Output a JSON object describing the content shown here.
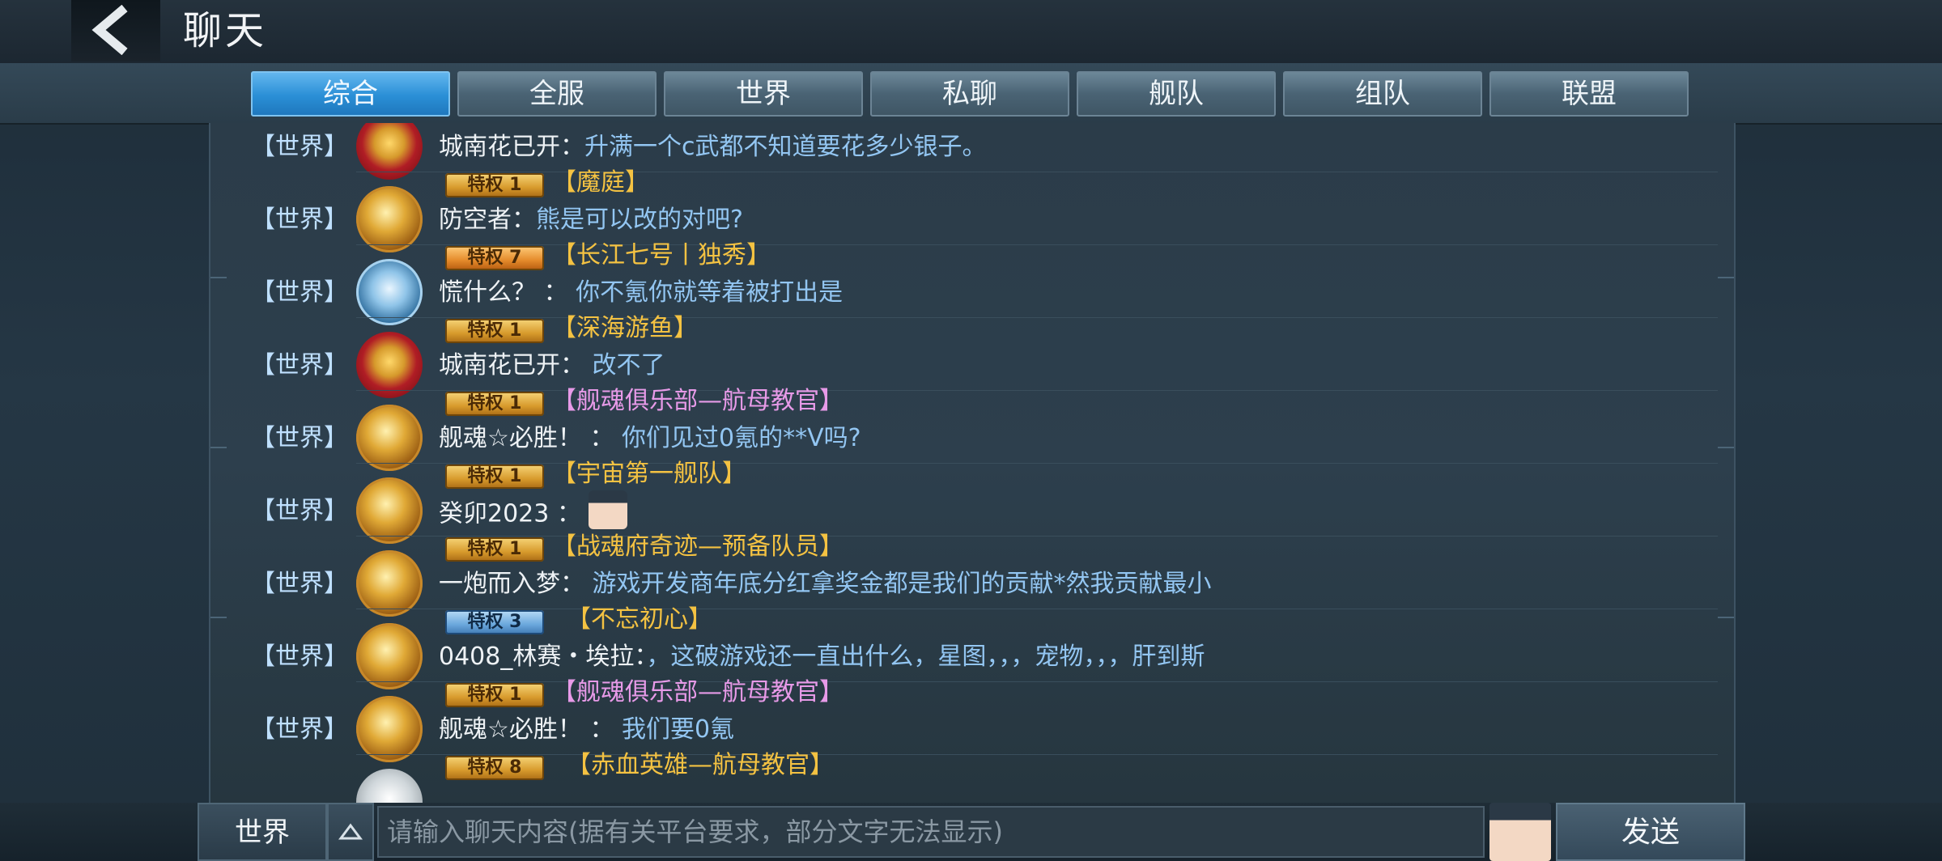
{
  "header": {
    "title": "聊天",
    "back_icon": "chevron-left-icon"
  },
  "tabs": [
    {
      "label": "综合",
      "active": true
    },
    {
      "label": "全服",
      "active": false
    },
    {
      "label": "世界",
      "active": false
    },
    {
      "label": "私聊",
      "active": false
    },
    {
      "label": "舰队",
      "active": false
    },
    {
      "label": "组队",
      "active": false
    },
    {
      "label": "联盟",
      "active": false
    }
  ],
  "messages": [
    {
      "channel": "【世界】",
      "vip": "",
      "guild": "",
      "name": "城南花已开",
      "text": "升满一个c武都不知道要花多少银子。",
      "avatar": "red"
    },
    {
      "channel": "【世界】",
      "vip": "特权 1",
      "guild": "【魔庭】",
      "name": "防空者",
      "text": "熊是可以改的对吧?",
      "avatar": "gold"
    },
    {
      "channel": "【世界】",
      "vip": "特权 7",
      "guild": "【长江七号丨独秀】",
      "name": "慌什么？",
      "text": "你不氪你就等着被打出是",
      "avatar": "blue"
    },
    {
      "channel": "【世界】",
      "vip": "特权 1",
      "guild": "【深海游鱼】",
      "name": "城南花已开",
      "text": "改不了",
      "avatar": "red"
    },
    {
      "channel": "【世界】",
      "vip": "特权 1",
      "guild": "【舰魂俱乐部—航母教官】",
      "name": "舰魂☆必胜！",
      "text": "你们见过0氪的**V吗?",
      "avatar": "gold"
    },
    {
      "channel": "【世界】",
      "vip": "特权 1",
      "guild": "【宇宙第一舰队】",
      "name": "癸卯2023",
      "text": "",
      "avatar": "gold"
    },
    {
      "channel": "【世界】",
      "vip": "特权 1",
      "guild": "【战魂府奇迹—预备队员】",
      "name": "一炮而入梦",
      "text": "游戏开发商年底分红拿奖金都是我们的贡献*然我贡献最小",
      "avatar": "gold"
    },
    {
      "channel": "【世界】",
      "vip": "特权 3",
      "guild": "【不忘初心】",
      "name": "0408_林赛・埃拉",
      "text": "，这破游戏还一直出什么，星图，，，宠物，，，肝到斯",
      "avatar": "gold"
    },
    {
      "channel": "【世界】",
      "vip": "特权 1",
      "guild": "【舰魂俱乐部—航母教官】",
      "name": "舰魂☆必胜！",
      "text": "我们要0氪",
      "avatar": "gold"
    },
    {
      "channel": "",
      "vip": "特权 8",
      "guild": "【赤血英雄—航母教官】",
      "name": "",
      "text": "",
      "avatar": "silver"
    }
  ],
  "input": {
    "channel": "世界",
    "placeholder": "请输入聊天内容(据有关平台要求，部分文字无法显示)",
    "send_label": "发送",
    "expand_icon": "triangle-up-icon"
  },
  "colors": {
    "active_tab": "#2a8fd6",
    "guild_gold": "#f4c242",
    "guild_pink": "#e79ae8",
    "message_text": "#93c6f2"
  }
}
